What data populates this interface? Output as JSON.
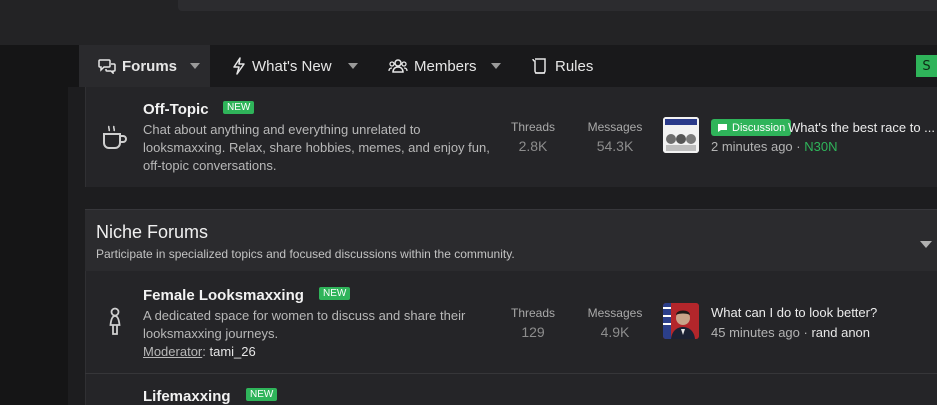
{
  "nav": {
    "tabs": [
      {
        "label": "Forums",
        "active": true
      },
      {
        "label": "What's New"
      },
      {
        "label": "Members"
      },
      {
        "label": "Rules"
      }
    ],
    "right_badge": "S"
  },
  "nodes": [
    {
      "title": "Off-Topic",
      "badge": "NEW",
      "description": [
        "Chat about anything and everything unrelated to",
        "looksmaxxing. Relax, share hobbies, memes, and enjoy fun,",
        "off-topic conversations."
      ],
      "icon": "coffee-cup-icon",
      "stats": {
        "threads_label": "Threads",
        "threads": "2.8K",
        "messages_label": "Messages",
        "messages": "54.3K"
      },
      "latest": {
        "prefix": "Discussion",
        "title": "What's the best race to ...",
        "time": "2 minutes ago",
        "separator": " · ",
        "author": "N30N",
        "author_color": "#2fb45a"
      }
    },
    {
      "title": "Female Looksmaxxing",
      "badge": "NEW",
      "description": [
        "A dedicated space for women to discuss and share their",
        "looksmaxxing journeys."
      ],
      "moderator_label": "Moderator",
      "moderator": "tami_26",
      "icon": "female-icon",
      "stats": {
        "threads_label": "Threads",
        "threads": "129",
        "messages_label": "Messages",
        "messages": "4.9K"
      },
      "latest": {
        "title": "What can I do to look better?",
        "time": "45 minutes ago",
        "separator": " · ",
        "author": "rand anon"
      }
    },
    {
      "title": "Lifemaxxing",
      "badge": "NEW"
    }
  ],
  "category": {
    "title": "Niche Forums",
    "description": "Participate in specialized topics and focused discussions within the community."
  },
  "colors": {
    "accent": "#2fb45a",
    "background": "#1b1b1d",
    "panel": "#252528"
  }
}
